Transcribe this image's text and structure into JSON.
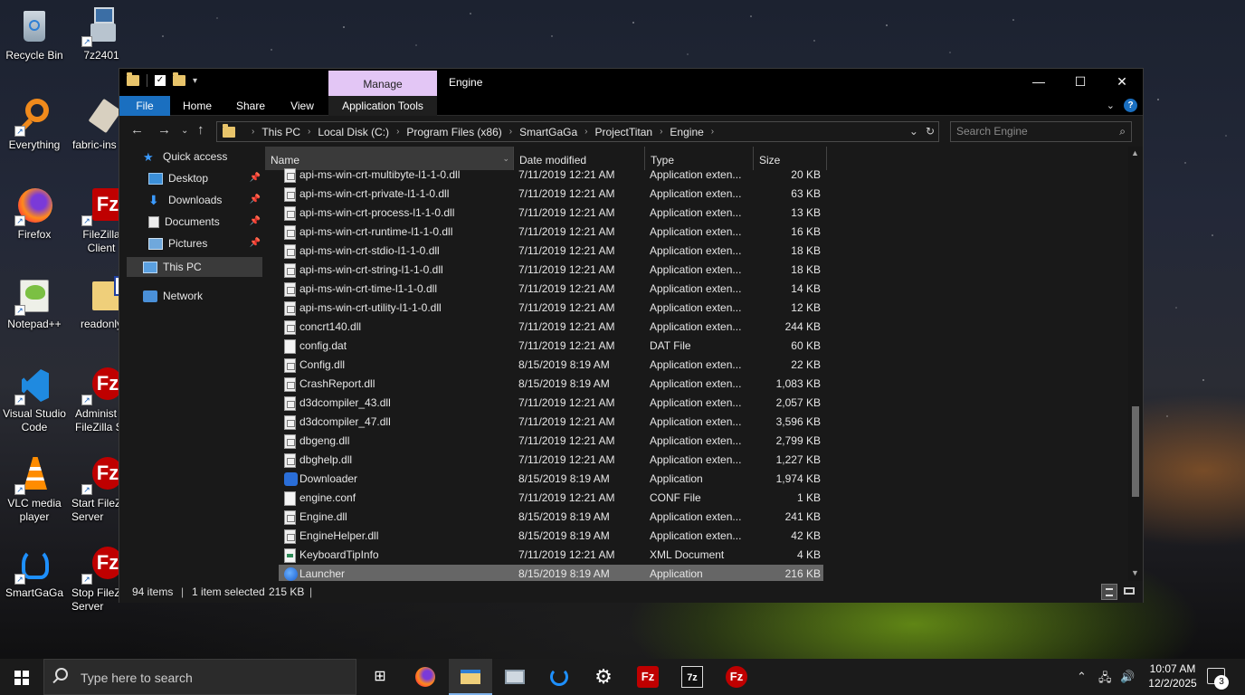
{
  "desktop": {
    "icons": [
      {
        "label": "Recycle Bin"
      },
      {
        "label": "7z2401"
      },
      {
        "label": "Everything"
      },
      {
        "label": "fabric-ins"
      },
      {
        "label": "Firefox"
      },
      {
        "label": "FileZilla Client"
      },
      {
        "label": "Notepad++"
      },
      {
        "label": "readonly"
      },
      {
        "label": "Visual Studio Code"
      },
      {
        "label": "Administ FileZilla S"
      },
      {
        "label": "VLC media player"
      },
      {
        "label": "Start FileZ Server"
      },
      {
        "label": "SmartGaGa"
      },
      {
        "label": "Stop FileZ Server"
      }
    ]
  },
  "window": {
    "title": "Engine",
    "manage_tab": "Manage",
    "ribbon_tabs": {
      "file": "File",
      "home": "Home",
      "share": "Share",
      "view": "View",
      "app_tools": "Application Tools"
    },
    "help": "?",
    "address": [
      "This PC",
      "Local Disk (C:)",
      "Program Files (x86)",
      "SmartGaGa",
      "ProjectTitan",
      "Engine"
    ],
    "search_placeholder": "Search Engine",
    "nav": {
      "quick_access": "Quick access",
      "desktop": "Desktop",
      "downloads": "Downloads",
      "documents": "Documents",
      "pictures": "Pictures",
      "this_pc": "This PC",
      "network": "Network"
    },
    "columns": {
      "name": "Name",
      "date": "Date modified",
      "type": "Type",
      "size": "Size"
    },
    "files": [
      {
        "name": "api-ms-win-crt-multibyte-l1-1-0.dll",
        "date": "7/11/2019 12:21 AM",
        "type": "Application exten...",
        "size": "20 KB",
        "icon": "dll"
      },
      {
        "name": "api-ms-win-crt-private-l1-1-0.dll",
        "date": "7/11/2019 12:21 AM",
        "type": "Application exten...",
        "size": "63 KB",
        "icon": "dll"
      },
      {
        "name": "api-ms-win-crt-process-l1-1-0.dll",
        "date": "7/11/2019 12:21 AM",
        "type": "Application exten...",
        "size": "13 KB",
        "icon": "dll"
      },
      {
        "name": "api-ms-win-crt-runtime-l1-1-0.dll",
        "date": "7/11/2019 12:21 AM",
        "type": "Application exten...",
        "size": "16 KB",
        "icon": "dll"
      },
      {
        "name": "api-ms-win-crt-stdio-l1-1-0.dll",
        "date": "7/11/2019 12:21 AM",
        "type": "Application exten...",
        "size": "18 KB",
        "icon": "dll"
      },
      {
        "name": "api-ms-win-crt-string-l1-1-0.dll",
        "date": "7/11/2019 12:21 AM",
        "type": "Application exten...",
        "size": "18 KB",
        "icon": "dll"
      },
      {
        "name": "api-ms-win-crt-time-l1-1-0.dll",
        "date": "7/11/2019 12:21 AM",
        "type": "Application exten...",
        "size": "14 KB",
        "icon": "dll"
      },
      {
        "name": "api-ms-win-crt-utility-l1-1-0.dll",
        "date": "7/11/2019 12:21 AM",
        "type": "Application exten...",
        "size": "12 KB",
        "icon": "dll"
      },
      {
        "name": "concrt140.dll",
        "date": "7/11/2019 12:21 AM",
        "type": "Application exten...",
        "size": "244 KB",
        "icon": "dll"
      },
      {
        "name": "config.dat",
        "date": "7/11/2019 12:21 AM",
        "type": "DAT File",
        "size": "60 KB",
        "icon": "file"
      },
      {
        "name": "Config.dll",
        "date": "8/15/2019 8:19 AM",
        "type": "Application exten...",
        "size": "22 KB",
        "icon": "dll"
      },
      {
        "name": "CrashReport.dll",
        "date": "8/15/2019 8:19 AM",
        "type": "Application exten...",
        "size": "1,083 KB",
        "icon": "dll"
      },
      {
        "name": "d3dcompiler_43.dll",
        "date": "7/11/2019 12:21 AM",
        "type": "Application exten...",
        "size": "2,057 KB",
        "icon": "dll"
      },
      {
        "name": "d3dcompiler_47.dll",
        "date": "7/11/2019 12:21 AM",
        "type": "Application exten...",
        "size": "3,596 KB",
        "icon": "dll"
      },
      {
        "name": "dbgeng.dll",
        "date": "7/11/2019 12:21 AM",
        "type": "Application exten...",
        "size": "2,799 KB",
        "icon": "dll"
      },
      {
        "name": "dbghelp.dll",
        "date": "7/11/2019 12:21 AM",
        "type": "Application exten...",
        "size": "1,227 KB",
        "icon": "dll"
      },
      {
        "name": "Downloader",
        "date": "8/15/2019 8:19 AM",
        "type": "Application",
        "size": "1,974 KB",
        "icon": "downloader"
      },
      {
        "name": "engine.conf",
        "date": "7/11/2019 12:21 AM",
        "type": "CONF File",
        "size": "1 KB",
        "icon": "file"
      },
      {
        "name": "Engine.dll",
        "date": "8/15/2019 8:19 AM",
        "type": "Application exten...",
        "size": "241 KB",
        "icon": "dll"
      },
      {
        "name": "EngineHelper.dll",
        "date": "8/15/2019 8:19 AM",
        "type": "Application exten...",
        "size": "42 KB",
        "icon": "dll"
      },
      {
        "name": "KeyboardTipInfo",
        "date": "7/11/2019 12:21 AM",
        "type": "XML Document",
        "size": "4 KB",
        "icon": "xml"
      },
      {
        "name": "Launcher",
        "date": "8/15/2019 8:19 AM",
        "type": "Application",
        "size": "216 KB",
        "icon": "app",
        "selected": true
      }
    ],
    "status": {
      "items": "94 items",
      "selected": "1 item selected",
      "size": "215 KB"
    }
  },
  "taskbar": {
    "search_placeholder": "Type here to search",
    "clock_time": "10:07 AM",
    "clock_date": "12/2/2025",
    "notifications": "3"
  }
}
